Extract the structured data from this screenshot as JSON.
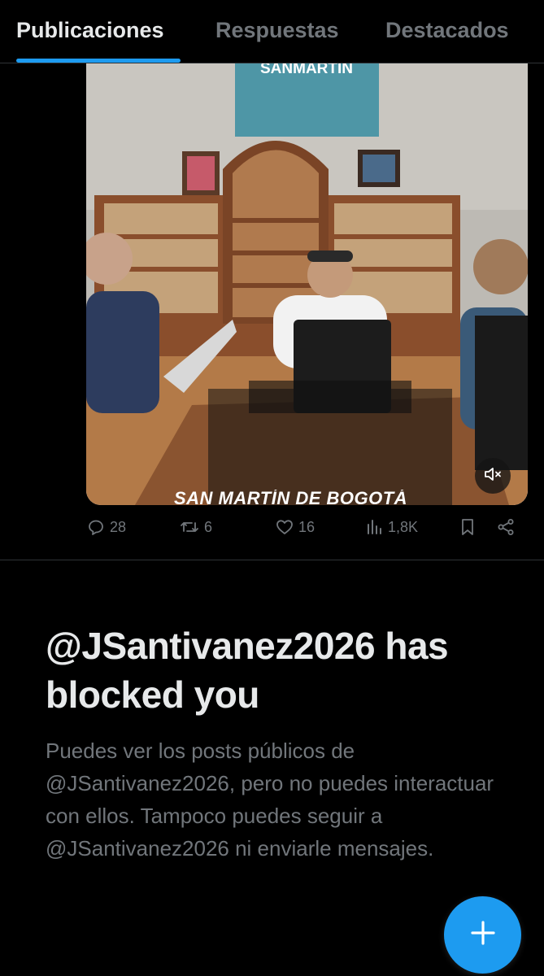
{
  "tabs": [
    {
      "label": "Publicaciones",
      "active": true
    },
    {
      "label": "Respuestas",
      "active": false
    },
    {
      "label": "Destacados",
      "active": false
    }
  ],
  "media": {
    "banner_text": "SANMARTIN",
    "caption_text": "SAN MARTÍN DE BOGOTÁ",
    "mute_icon": "volume-muted-icon"
  },
  "actions": {
    "replies": "28",
    "reposts": "6",
    "likes": "16",
    "views": "1,8K"
  },
  "blocked": {
    "title": "@JSantivanez2026 has blocked you",
    "description": "Puedes ver los posts públicos de @JSantivanez2026, pero no puedes interactuar con ellos. Tampoco puedes seguir a @JSantivanez2026 ni enviarle mensajes."
  },
  "colors": {
    "accent": "#1d9bf0",
    "background": "#000000",
    "text_primary": "#e7e9ea",
    "text_secondary": "#71767b"
  }
}
